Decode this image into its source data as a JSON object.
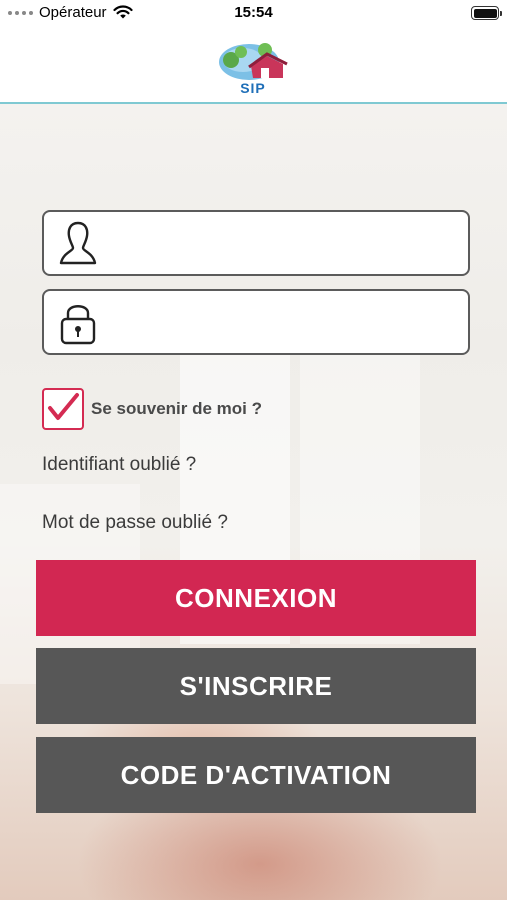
{
  "status_bar": {
    "carrier": "Opérateur",
    "time": "15:54"
  },
  "header": {
    "logo_text": "SIP"
  },
  "login": {
    "username_placeholder": "",
    "password_placeholder": "",
    "remember_label": "Se souvenir de moi ?",
    "remember_checked": true,
    "forgot_id": "Identifiant oublié ?",
    "forgot_password": "Mot de passe oublié ?"
  },
  "buttons": {
    "connexion": "CONNEXION",
    "inscrire": "S'INSCRIRE",
    "activation": "CODE D'ACTIVATION"
  },
  "colors": {
    "primary": "#d22752",
    "dark_button": "#575757",
    "header_border": "#7fc9d2",
    "logo_blue": "#1f6fb8"
  },
  "icons": {
    "username": "user-icon",
    "password": "lock-icon",
    "checkbox": "checkmark-icon",
    "wifi": "wifi-icon",
    "battery": "battery-icon"
  }
}
